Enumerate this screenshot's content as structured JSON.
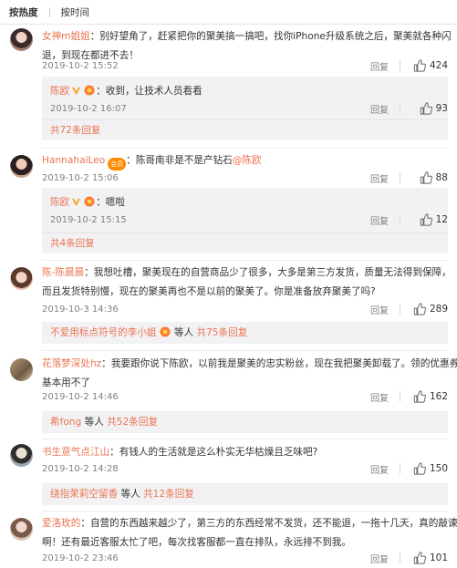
{
  "sort_tabs": {
    "hot": "按热度",
    "time": "按时间"
  },
  "reply_label": "回复",
  "comments": [
    {
      "user": "女神m姐姐",
      "text1": "：别好望角了，赶紧把你的聚美搞一搞吧，找你iPhone升级系统之后，聚美就各种闪",
      "text2": "退，到现在都进不去！",
      "time": "2019-10-2 15:52",
      "likes": "424",
      "sub": {
        "user": "陈欧",
        "text": "：收到，让技术人员看看",
        "time": "2019-10-2 16:07",
        "likes": "93",
        "more": "共72条回复"
      }
    },
    {
      "user": "HannahaiLeo",
      "badge": "会员",
      "text1": "：陈哥南非是不是产钻石",
      "mention": "@陈欧",
      "time": "2019-10-2 15:06",
      "likes": "88",
      "sub": {
        "user": "陈欧",
        "text": "：嗯啦",
        "time": "2019-10-2 15:15",
        "likes": "12",
        "more": "共4条回复"
      }
    },
    {
      "user": "陈-陈晨晨",
      "text1": "：我想吐槽，聚美现在的自营商品少了很多，大多是第三方发货，质量无法得到保障，",
      "text2": "而且发货特别慢，现在的聚美再也不是以前的聚美了。你是准备放弃聚美了吗?",
      "time": "2019-10-3 14:36",
      "likes": "289",
      "sub2": {
        "user": "不爱用标点符号的李小姐",
        "mid": "等人",
        "more": "共75条回复"
      }
    },
    {
      "user": "花落梦深处hz",
      "text1": "：我要跟你说下陈欧，以前我是聚美的忠实粉丝，现在我把聚美卸载了。领的优惠券，",
      "text2": "基本用不了",
      "time": "2019-10-2 14:46",
      "likes": "162",
      "sub2": {
        "user": "希fong",
        "mid": "等人",
        "more": "共52条回复"
      }
    },
    {
      "user": "书生意气点江山",
      "text1": "：有钱人的生活就是这么朴实无华枯燥且乏味吧?",
      "time": "2019-10-2 14:28",
      "likes": "150",
      "sub2": {
        "user": "绕指茉莉空留香",
        "mid": "等人",
        "more": "共12条回复"
      }
    },
    {
      "user": "爱洛玫的",
      "text1": "：自营的东西越来越少了，第三方的东西经常不发货，还不能退，一拖十几天，真的敲谏事",
      "text2": "啊！还有最近客服太忙了吧，每次找客服都一直在排队，永远排不到我。",
      "time": "2019-10-2 23:46",
      "likes": "101"
    }
  ],
  "colors": {
    "accent": "#eb7350",
    "sub_bg": "#f2f2f5",
    "meta": "#808080"
  }
}
